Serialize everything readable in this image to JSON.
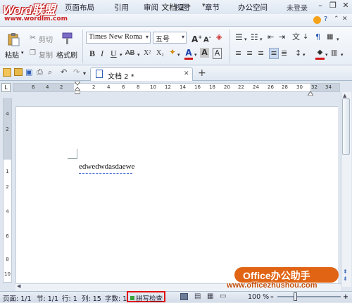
{
  "logo": {
    "main": "Word联盟",
    "sub": "www.wordlm.com"
  },
  "title": {
    "text": "文档 2 *",
    "dropdown": "▾"
  },
  "window": {
    "minimize": "–",
    "restore": "❐",
    "close": "✕"
  },
  "menu": {
    "items": [
      "页面布局",
      "引用",
      "审阅",
      "视图",
      "章节",
      "办公空间"
    ],
    "not_logged_in": "未登录"
  },
  "ribbon": {
    "paste": "粘贴",
    "cut": "剪切",
    "copy": "复制",
    "format_painter": "格式刷",
    "font_name": "Times New Roma",
    "font_size": "五号",
    "bold": "B",
    "italic": "I",
    "underline": "U",
    "strike": "AB",
    "superscript": "X²",
    "subscript": "X₂"
  },
  "tabbar": {
    "doc_tab": "文档 2 *",
    "close": "✕",
    "new_tab": "+"
  },
  "ruler": {
    "h_numbers": [
      "6",
      "4",
      "2",
      "2",
      "4",
      "6",
      "8",
      "10",
      "12",
      "14",
      "16",
      "18",
      "20",
      "22",
      "24",
      "26",
      "28",
      "30",
      "32",
      "34",
      "36",
      "38"
    ],
    "v_numbers": [
      "4",
      "2",
      "1",
      "2",
      "4",
      "6",
      "8",
      "10"
    ]
  },
  "document": {
    "text": "edwedwdasdaewe"
  },
  "status": {
    "page": "页面: 1/1",
    "section": "节: 1/1",
    "row": "行: 1",
    "col": "列: 15",
    "words": "字数: 1",
    "spell": "拼写检查",
    "zoom": "100 %",
    "zoom_minus": "–",
    "zoom_plus": "+"
  },
  "watermark": {
    "title": "Office办公助手",
    "url": "www.officezhushou.com"
  },
  "colors": {
    "accent": "#2a5bb5",
    "watermark": "#e06414",
    "spell_border": "#e01010"
  }
}
